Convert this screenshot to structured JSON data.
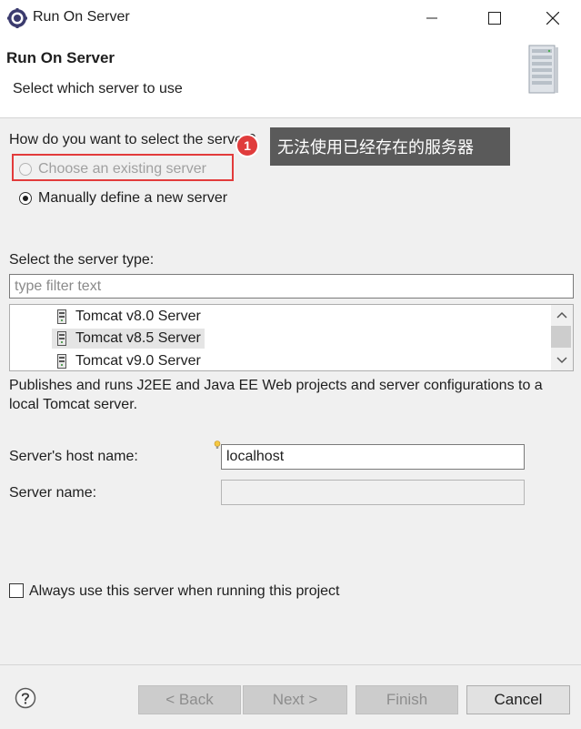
{
  "window": {
    "title": "Run On Server",
    "icon": "eclipse-gear-icon"
  },
  "banner": {
    "title": "Run On Server",
    "description": "Select which server to use",
    "image": "server-tower-icon"
  },
  "selection": {
    "question": "How do you want to select the server?",
    "existing_option": "Choose an existing server",
    "manual_option": "Manually define a new server",
    "selected": "manual"
  },
  "annotation": {
    "badge": "1",
    "tooltip": "无法使用已经存在的服务器",
    "highlight_color": "#e23b3b"
  },
  "server_type": {
    "label": "Select the server type:",
    "filter_placeholder": "type filter text",
    "items": [
      {
        "label": "Tomcat v8.0 Server",
        "selected": false
      },
      {
        "label": "Tomcat v8.5 Server",
        "selected": true
      },
      {
        "label": "Tomcat v9.0 Server",
        "selected": false
      }
    ],
    "description": "Publishes and runs J2EE and Java EE Web projects and server configurations to a local Tomcat server."
  },
  "host": {
    "label": "Server's host name:",
    "value": "localhost"
  },
  "server_name": {
    "label": "Server name:",
    "value": ""
  },
  "always_use": {
    "label": "Always use this server when running this project",
    "checked": false
  },
  "buttons": {
    "back": "< Back",
    "next": "Next >",
    "finish": "Finish",
    "cancel": "Cancel"
  }
}
